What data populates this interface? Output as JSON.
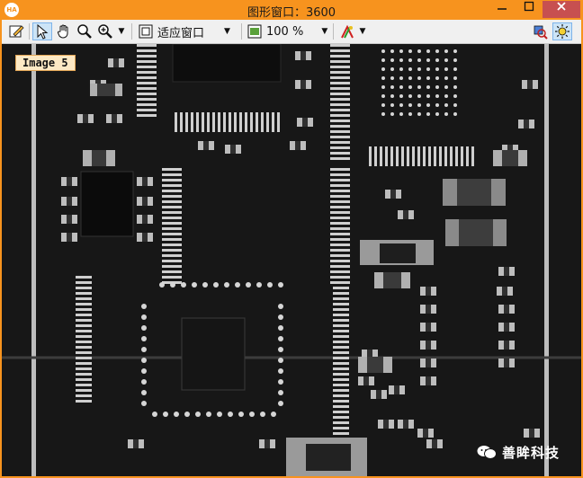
{
  "window": {
    "title": "图形窗口：3600",
    "app_badge": "HA"
  },
  "toolbar": {
    "fit_label": "适应窗口",
    "zoom_label": "100 %"
  },
  "canvas": {
    "image_label": "Image 5",
    "watermark": "善眸科技"
  },
  "colors": {
    "frame": "#f7931e",
    "toolbar_bg": "#f0f0f0",
    "canvas_bg": "#171717",
    "label_bg": "#fde9c4"
  }
}
